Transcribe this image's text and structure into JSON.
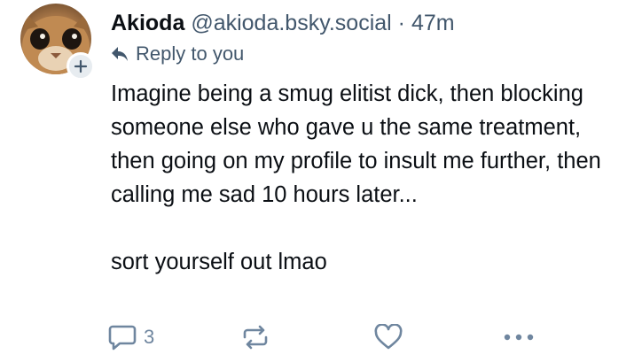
{
  "post": {
    "author": {
      "display_name": "Akioda",
      "handle": "@akioda.bsky.social",
      "separator": "·",
      "timestamp": "47m",
      "avatar_icon": "cat-avatar",
      "follow_icon": "plus-icon"
    },
    "reply_context": {
      "icon": "reply-arrow-icon",
      "label": "Reply to you"
    },
    "body": {
      "paragraph_1": "Imagine being a smug elitist dick, then blocking someone else who gave u the same treatment, then going on my profile to insult me further, then calling me sad 10 hours later...",
      "paragraph_2": "sort yourself out lmao"
    },
    "actions": {
      "reply_count": "3",
      "reply_icon": "comment-icon",
      "repost_icon": "repost-icon",
      "like_icon": "heart-icon",
      "more_icon": "more-icon"
    }
  },
  "colors": {
    "text": "#0b0f14",
    "muted": "#42576c",
    "icon": "#6f869f",
    "badge_bg": "#e7ecf0"
  }
}
